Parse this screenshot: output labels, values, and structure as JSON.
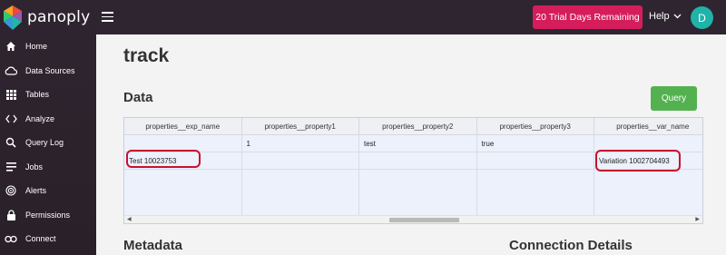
{
  "app": {
    "brand": "panoply"
  },
  "sidebar": {
    "items": [
      {
        "label": "Home",
        "icon": "home-icon"
      },
      {
        "label": "Data Sources",
        "icon": "cloud-icon"
      },
      {
        "label": "Tables",
        "icon": "grid-icon"
      },
      {
        "label": "Analyze",
        "icon": "code-icon"
      },
      {
        "label": "Query Log",
        "icon": "search-icon"
      },
      {
        "label": "Jobs",
        "icon": "list-icon"
      },
      {
        "label": "Alerts",
        "icon": "radar-icon"
      },
      {
        "label": "Permissions",
        "icon": "lock-icon"
      },
      {
        "label": "Connect",
        "icon": "link-icon"
      }
    ]
  },
  "topbar": {
    "trial_label": "20 Trial Days Remaining",
    "help_label": "Help",
    "avatar_initial": "D"
  },
  "main": {
    "title": "track",
    "data_section": "Data",
    "query_label": "Query",
    "metadata_section": "Metadata",
    "connection_section": "Connection Details"
  },
  "table": {
    "columns": [
      "properties__exp_name",
      "properties__property1",
      "properties__property2",
      "properties__property3",
      "properties__var_name"
    ],
    "rows": [
      [
        "",
        "1",
        "test",
        "true",
        ""
      ],
      [
        "Test 10023753",
        "",
        "",
        "",
        "Variation 1002704493"
      ]
    ]
  },
  "colors": {
    "sidebar_bg": "#2f2530",
    "trial_button": "#d51d5c",
    "query_button": "#53b150",
    "avatar": "#1fb3a9",
    "highlight": "#c8102e"
  }
}
